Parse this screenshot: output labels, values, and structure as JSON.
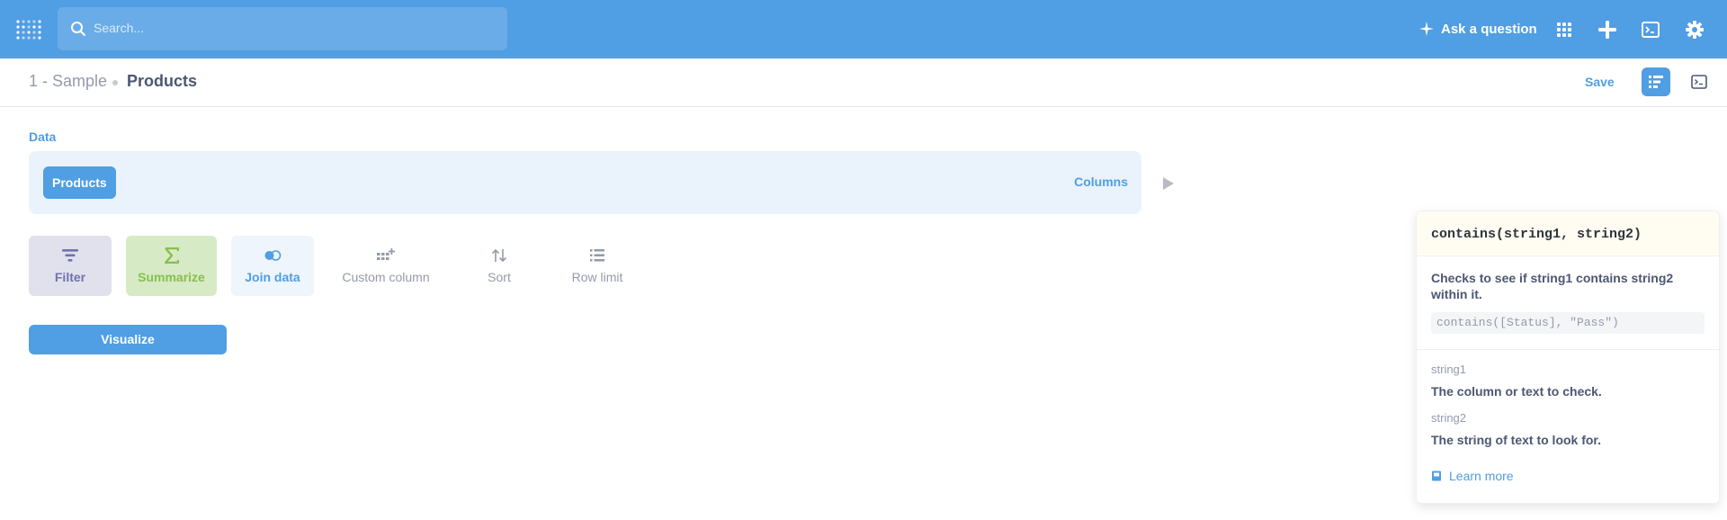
{
  "topbar": {
    "search_placeholder": "Search...",
    "ask_label": "Ask a question",
    "icons": [
      "apps-grid-icon",
      "plus-icon",
      "sql-editor-icon",
      "gear-icon"
    ]
  },
  "header": {
    "database": "1 - Sample",
    "table": "Products",
    "save_label": "Save"
  },
  "data_section": {
    "label": "Data",
    "source": "Products",
    "columns_label": "Columns"
  },
  "actions": {
    "filter": "Filter",
    "summarize": "Summarize",
    "join": "Join data",
    "custom_column": "Custom column",
    "sort": "Sort",
    "row_limit": "Row limit",
    "visualize": "Visualize"
  },
  "help": {
    "signature": "contains(string1, string2)",
    "description": "Checks to see if string1 contains string2 within it.",
    "example": "contains([Status], \"Pass\")",
    "args": [
      {
        "name": "string1",
        "description": "The column or text to check."
      },
      {
        "name": "string2",
        "description": "The string of text to look for."
      }
    ],
    "learn_more": "Learn more"
  },
  "colors": {
    "brand": "#509ee3",
    "filter": "#7172ad",
    "summarize": "#88bf4d",
    "text_dark": "#4c5773",
    "text_light": "#949aab"
  }
}
